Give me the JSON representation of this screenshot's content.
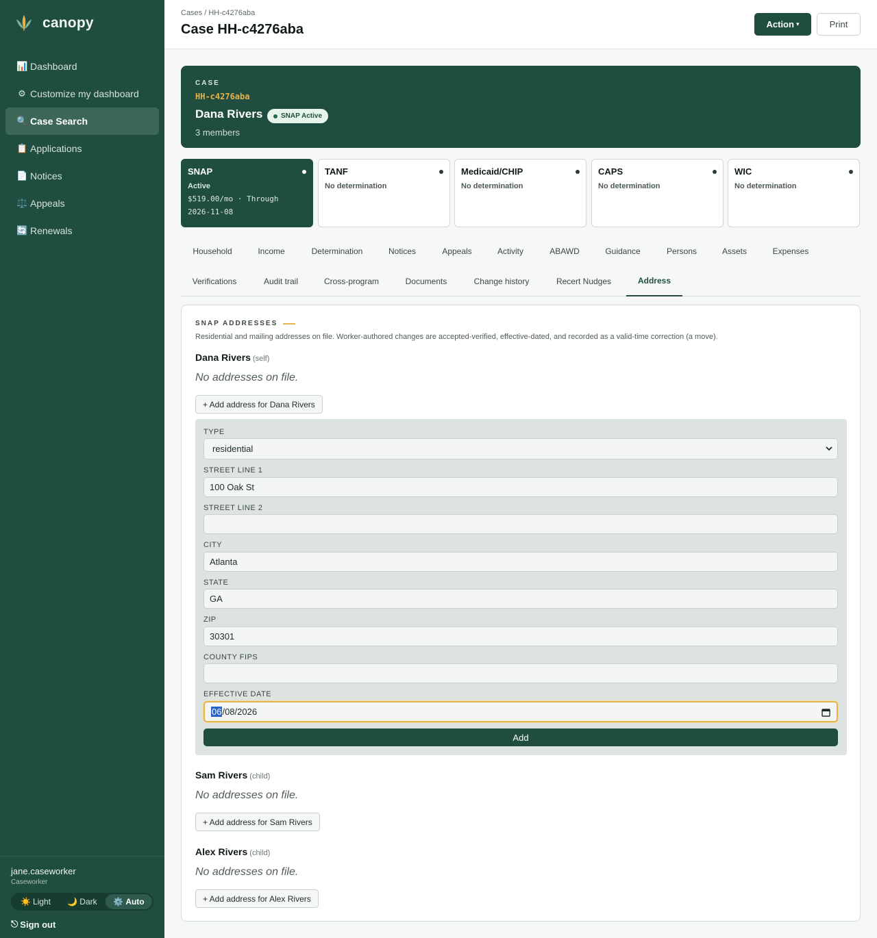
{
  "app": {
    "name": "canopy"
  },
  "nav": {
    "items": [
      {
        "icon": "📊",
        "label": "Dashboard"
      },
      {
        "icon": "⚙",
        "label": "Customize my dashboard"
      },
      {
        "icon": "🔍",
        "label": "Case Search"
      },
      {
        "icon": "📋",
        "label": "Applications"
      },
      {
        "icon": "📄",
        "label": "Notices"
      },
      {
        "icon": "⚖️",
        "label": "Appeals"
      },
      {
        "icon": "🔄",
        "label": "Renewals"
      }
    ],
    "active": "Case Search"
  },
  "user": {
    "name": "jane.caseworker",
    "role": "Caseworker",
    "theme_options": [
      {
        "icon": "☀️",
        "label": "Light"
      },
      {
        "icon": "🌙",
        "label": "Dark"
      },
      {
        "icon": "⚙️",
        "label": "Auto"
      }
    ],
    "theme_active": "Auto",
    "sign_out": {
      "icon": "⎋",
      "label": "Sign out"
    }
  },
  "header": {
    "breadcrumb": "Cases / HH-c4276aba",
    "title": "Case HH-c4276aba",
    "action_label": "Action",
    "action_caret": "▾",
    "print_label": "Print"
  },
  "case": {
    "kicker": "CASE",
    "id": "HH-c4276aba",
    "name": "Dana Rivers",
    "badge": "SNAP Active",
    "members": "3 members"
  },
  "programs": [
    {
      "name": "SNAP",
      "status": "Active",
      "amount_line1": "$519.00/mo · Through",
      "amount_line2": "2026-11-08"
    },
    {
      "name": "TANF",
      "status": "No determination"
    },
    {
      "name": "Medicaid/CHIP",
      "status": "No determination"
    },
    {
      "name": "CAPS",
      "status": "No determination"
    },
    {
      "name": "WIC",
      "status": "No determination"
    }
  ],
  "tabs": [
    "Household",
    "Income",
    "Determination",
    "Notices",
    "Appeals",
    "Activity",
    "ABAWD",
    "Guidance",
    "Persons",
    "Assets",
    "Expenses",
    "Verifications",
    "Audit trail",
    "Cross-program",
    "Documents",
    "Change history",
    "Recert Nudges",
    "Address"
  ],
  "active_tab": "Address",
  "address_section": {
    "title": "SNAP ADDRESSES",
    "description": "Residential and mailing addresses on file. Worker-authored changes are accepted-verified, effective-dated, and recorded as a valid-time correction (a move).",
    "people": [
      {
        "name": "Dana Rivers",
        "relation": "(self)",
        "empty": "No addresses on file.",
        "add_label": "+ Add address for Dana Rivers"
      },
      {
        "name": "Sam Rivers",
        "relation": "(child)",
        "empty": "No addresses on file.",
        "add_label": "+ Add address for Sam Rivers"
      },
      {
        "name": "Alex Rivers",
        "relation": "(child)",
        "empty": "No addresses on file.",
        "add_label": "+ Add address for Alex Rivers"
      }
    ],
    "form": {
      "type_label": "TYPE",
      "type_value": "residential",
      "street1_label": "STREET LINE 1",
      "street1_value": "100 Oak St",
      "street2_label": "STREET LINE 2",
      "street2_value": "",
      "city_label": "CITY",
      "city_value": "Atlanta",
      "state_label": "STATE",
      "state_value": "GA",
      "zip_label": "ZIP",
      "zip_value": "30301",
      "fips_label": "COUNTY FIPS",
      "fips_value": "",
      "date_label": "EFFECTIVE DATE",
      "date_month": "06",
      "date_rest": "/08/2026",
      "submit_label": "Add"
    }
  },
  "colors": {
    "sidebar": "#1f4d40",
    "accent": "#1f4d40",
    "highlight": "#e6b34a",
    "badge_bg": "#e7f4ea"
  }
}
